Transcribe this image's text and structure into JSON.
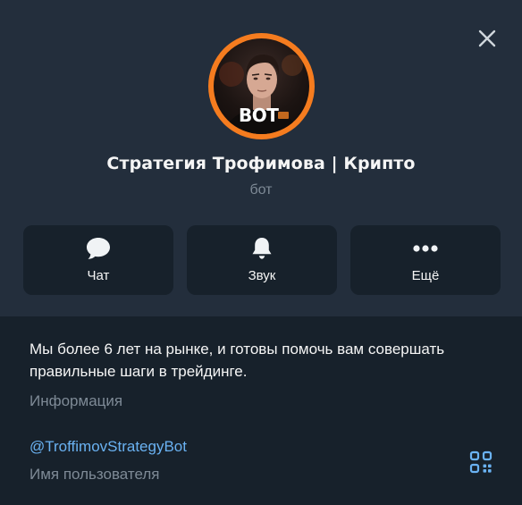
{
  "profile": {
    "name": "Стратегия Трофимова | Крипто",
    "kind": "бот",
    "avatar_badge": "BOT",
    "avatar_ring_color": "#f57c1f"
  },
  "actions": [
    {
      "label": "Чат",
      "icon": "chat-bubble-icon"
    },
    {
      "label": "Звук",
      "icon": "bell-icon"
    },
    {
      "label": "Ещё",
      "icon": "more-dots-icon"
    }
  ],
  "info": {
    "about": "Мы более 6 лет на рынке, и готовы помочь вам совершать правильные шаги в трейдинге.",
    "about_label": "Информация",
    "username": "@TroffimovStrategyBot",
    "username_label": "Имя пользователя"
  },
  "icons": {
    "close": "close-icon",
    "qr": "qr-code-icon"
  },
  "colors": {
    "header_bg": "#232e3c",
    "body_bg": "#17212b",
    "link": "#6ab2f2",
    "muted": "#7e8a96"
  }
}
